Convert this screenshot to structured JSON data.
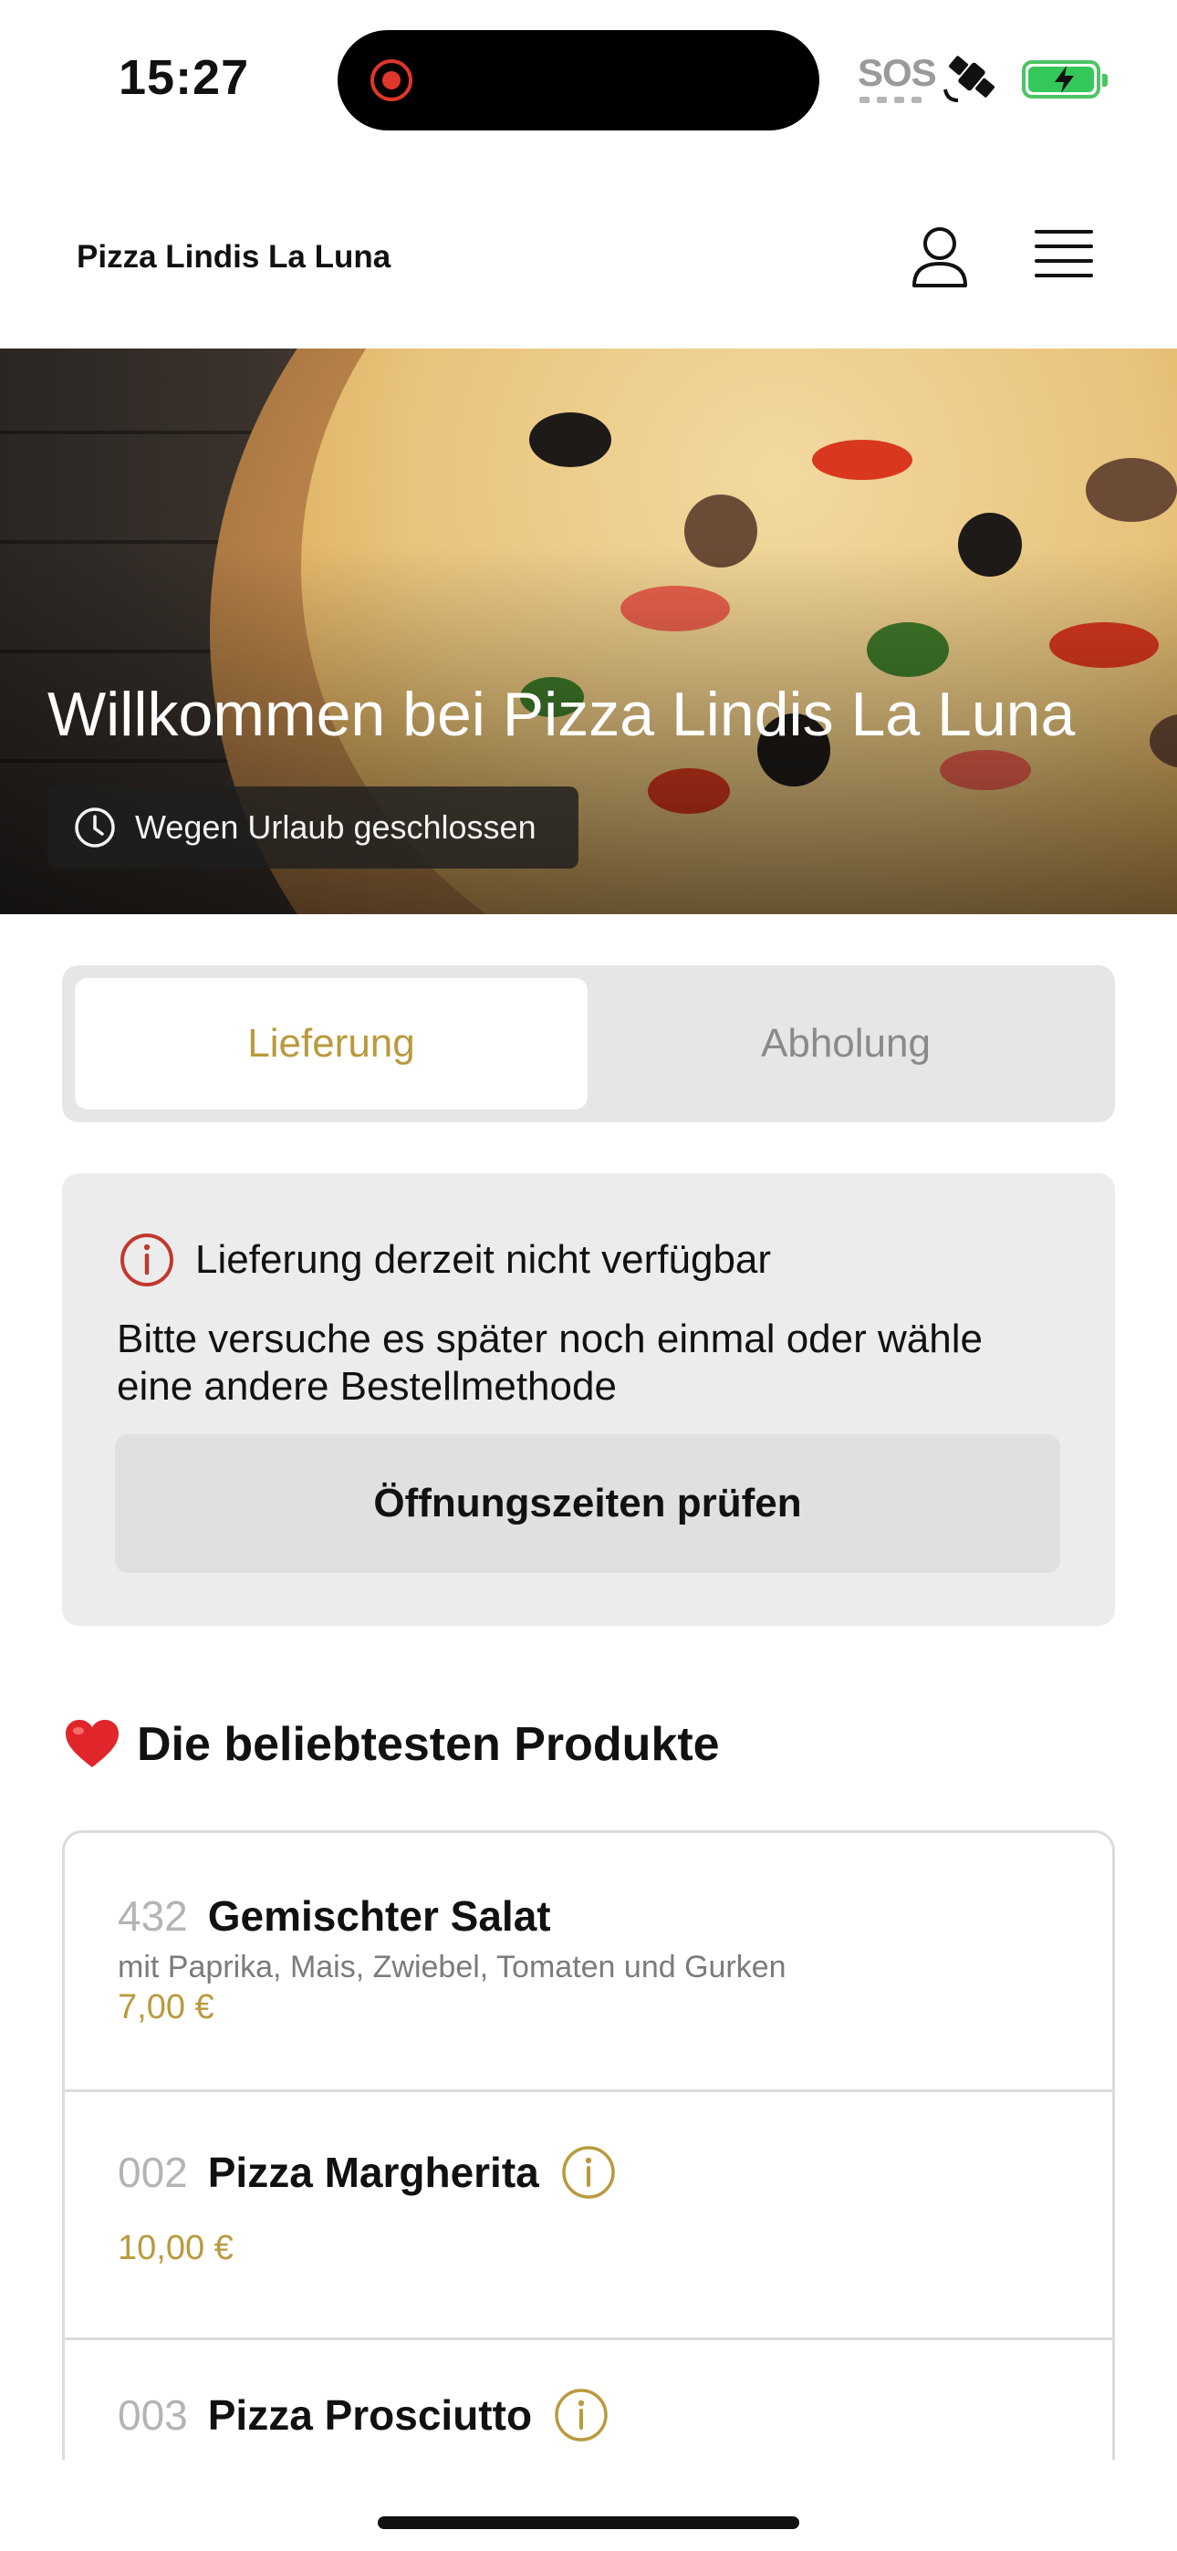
{
  "status_bar": {
    "time": "15:27",
    "sos": "SOS",
    "icons": [
      "screen-recording-icon",
      "satellite-icon",
      "battery-charging-icon"
    ]
  },
  "header": {
    "title": "Pizza Lindis La Luna",
    "icons": [
      "user-icon",
      "menu-icon"
    ]
  },
  "hero": {
    "title": "Willkommen bei Pizza Lindis La Luna",
    "status": "Wegen Urlaub geschlossen",
    "status_icon": "clock-icon"
  },
  "tabs": [
    {
      "label": "Lieferung",
      "active": true
    },
    {
      "label": "Abholung",
      "active": false
    }
  ],
  "notice": {
    "title": "Lieferung derzeit nicht verfügbar",
    "text": "Bitte versuche es später noch einmal oder wähle eine andere Bestellmethode",
    "button": "Öffnungszeiten prüfen",
    "icon": "info-alert-icon",
    "icon_color": "#c0392b"
  },
  "popular": {
    "title": "Die beliebtesten Produkte",
    "icon": "heart-icon",
    "products": [
      {
        "number": "432",
        "name": "Gemischter Salat",
        "description": "mit Paprika, Mais, Zwiebel, Tomaten und Gurken",
        "price": "7,00 €"
      },
      {
        "number": "002",
        "name": "Pizza Margherita",
        "price": "10,00 €",
        "info_icon": "info-icon"
      },
      {
        "number": "003",
        "name": "Pizza Prosciutto",
        "info_icon": "info-icon"
      }
    ]
  },
  "colors": {
    "accent": "#b99a3d",
    "alert": "#c0392b",
    "background": "#ffffff",
    "card": "#ececec"
  }
}
